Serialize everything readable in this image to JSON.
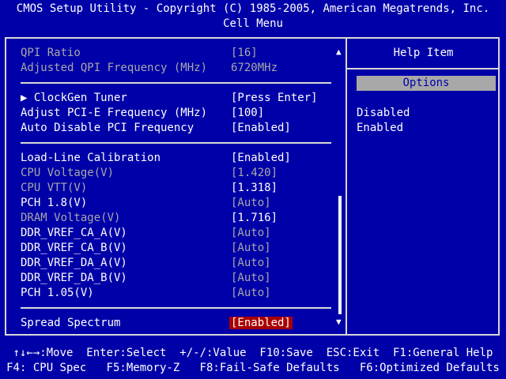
{
  "header": {
    "line1": "CMOS Setup Utility - Copyright (C) 1985-2005, American Megatrends, Inc.",
    "line2": "Cell Menu"
  },
  "settings": [
    {
      "label": "QPI Ratio",
      "value": "[16]"
    },
    {
      "label": "Adjusted QPI Frequency (MHz)",
      "value": "6720MHz"
    },
    {
      "label": "▶ ClockGen Tuner",
      "value": "[Press Enter]"
    },
    {
      "label": "Adjust PCI-E Frequency (MHz)",
      "value": "[100]"
    },
    {
      "label": "Auto Disable PCI Frequency",
      "value": "[Enabled]"
    },
    {
      "label": "Load-Line Calibration",
      "value": "[Enabled]"
    },
    {
      "label": "CPU Voltage(V)",
      "value": "[1.420]"
    },
    {
      "label": "CPU VTT(V)",
      "value": "[1.318]"
    },
    {
      "label": "PCH 1.8(V)",
      "value": "[Auto]"
    },
    {
      "label": "DRAM Voltage(V)",
      "value": "[1.716]"
    },
    {
      "label": "DDR_VREF_CA_A(V)",
      "value": "[Auto]"
    },
    {
      "label": "DDR_VREF_CA_B(V)",
      "value": "[Auto]"
    },
    {
      "label": "DDR_VREF_DA_A(V)",
      "value": "[Auto]"
    },
    {
      "label": "DDR_VREF_DA_B(V)",
      "value": "[Auto]"
    },
    {
      "label": "PCH 1.05(V)",
      "value": "[Auto]"
    },
    {
      "label": "Spread Spectrum",
      "value": "[Enabled]"
    }
  ],
  "scroll": {
    "up": "▲",
    "down": "▼"
  },
  "help": {
    "title": "Help Item",
    "options_header": "Options",
    "options": [
      "Disabled",
      "Enabled"
    ]
  },
  "footer": {
    "line1": "↑↓←→:Move  Enter:Select  +/-/:Value  F10:Save  ESC:Exit  F1:General Help",
    "line2": "F4: CPU Spec   F5:Memory-Z   F8:Fail-Safe Defaults   F6:Optimized Defaults"
  },
  "colors": {
    "background": "#0000a8",
    "text": "#ffffff",
    "disabled_text": "#a8a8a8",
    "selection": "#a80000",
    "options_bar": "#a8a8a8"
  }
}
